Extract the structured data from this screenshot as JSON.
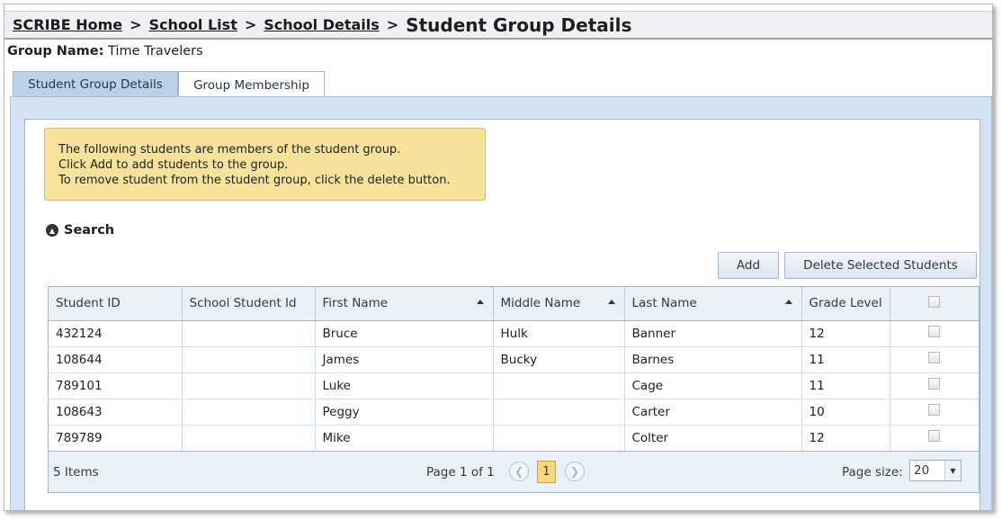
{
  "breadcrumb": {
    "items": [
      "SCRIBE Home",
      "School List",
      "School Details"
    ],
    "separator": ">",
    "current": "Student Group Details"
  },
  "group": {
    "label": "Group Name:",
    "value": "Time Travelers"
  },
  "tabs": [
    {
      "label": "Student Group Details",
      "active": false
    },
    {
      "label": "Group Membership",
      "active": true
    }
  ],
  "notice": {
    "lines": [
      "The following students are members of the student group.",
      "Click Add to add students to the group.",
      "To remove student from the student group, click the delete button."
    ]
  },
  "search": {
    "label": "Search",
    "icon": "collapse-circle-icon"
  },
  "toolbar": {
    "add_label": "Add",
    "delete_label": "Delete Selected Students"
  },
  "grid": {
    "columns": [
      "Student ID",
      "School Student Id",
      "First Name",
      "Middle Name",
      "Last Name",
      "Grade Level"
    ],
    "rows": [
      [
        "432124",
        "",
        "Bruce",
        "Hulk",
        "Banner",
        "12"
      ],
      [
        "108644",
        "",
        "James",
        "Bucky",
        "Barnes",
        "11"
      ],
      [
        "789101",
        "",
        "Luke",
        "",
        "Cage",
        "11"
      ],
      [
        "108643",
        "",
        "Peggy",
        "",
        "Carter",
        "10"
      ],
      [
        "789789",
        "",
        "Mike",
        "",
        "Colter",
        "12"
      ]
    ]
  },
  "pager": {
    "items_text": "5 Items",
    "page_info": "Page 1 of 1",
    "current_page": "1",
    "page_size_label": "Page size:",
    "page_size_value": "20"
  },
  "colors": {
    "tab_panel_bg": "#d4e3f3",
    "notice_bg": "#f6e29b",
    "current_page_bg": "#f8d77e"
  }
}
